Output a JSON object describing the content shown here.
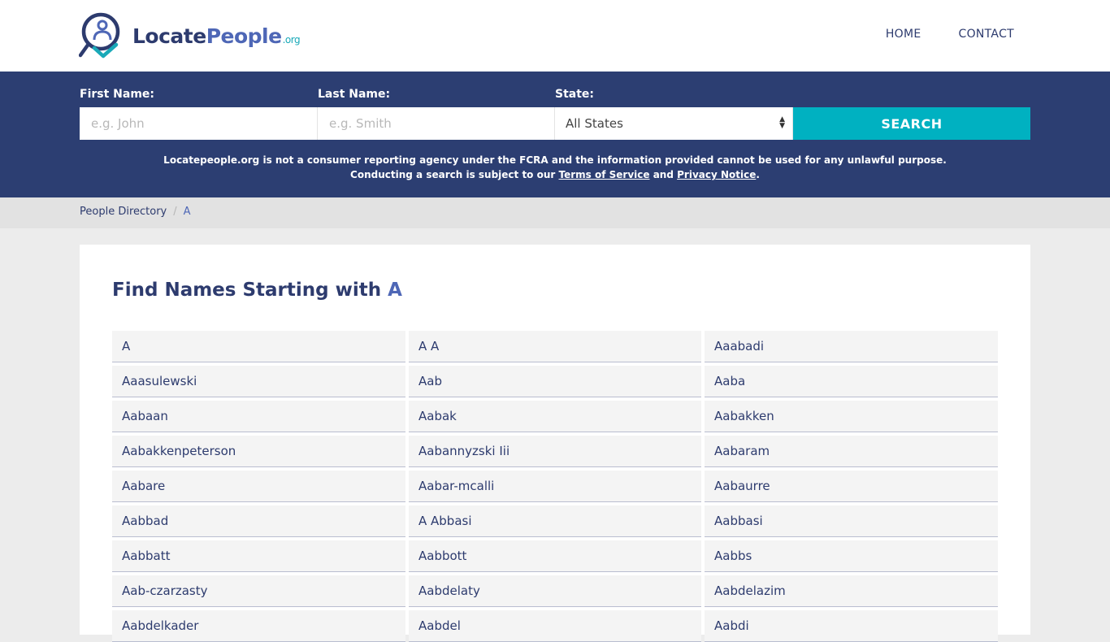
{
  "header": {
    "logo": {
      "locate": "Locate",
      "people": "People",
      "org": ".org",
      "icon": "location-pin-person-icon"
    },
    "nav": [
      {
        "label": "HOME"
      },
      {
        "label": "CONTACT"
      }
    ]
  },
  "search": {
    "first_name": {
      "label": "First Name:",
      "placeholder": "e.g. John",
      "value": ""
    },
    "last_name": {
      "label": "Last Name:",
      "placeholder": "e.g. Smith",
      "value": ""
    },
    "state": {
      "label": "State:",
      "selected": "All States"
    },
    "button_label": "SEARCH",
    "disclaimer_line1": "Locatepeople.org is not a consumer reporting agency under the FCRA and the information provided cannot be used for any unlawful purpose.",
    "disclaimer_line2_prefix": "Conducting a search is subject to our",
    "terms_link": "Terms of Service",
    "and_text": "and",
    "privacy_link": "Privacy Notice",
    "period": "."
  },
  "breadcrumb": {
    "root": "People Directory",
    "separator": "/",
    "current": "A"
  },
  "main": {
    "title_prefix": "Find Names Starting with",
    "title_letter": "A",
    "names": [
      "A",
      "A A",
      "Aaabadi",
      "Aaasulewski",
      "Aab",
      "Aaba",
      "Aabaan",
      "Aabak",
      "Aabakken",
      "Aabakkenpeterson",
      "Aabannyzski Iii",
      "Aabaram",
      "Aabare",
      "Aabar-mcalli",
      "Aabaurre",
      "Aabbad",
      "A Abbasi",
      "Aabbasi",
      "Aabbatt",
      "Aabbott",
      "Aabbs",
      "Aab-czarzasty",
      "Aabdelaty",
      "Aabdelazim",
      "Aabdelkader",
      "Aabdel",
      "Aabdi"
    ]
  },
  "colors": {
    "navy": "#2c3e72",
    "accent": "#00b1c1",
    "link_blue": "#4e67b6"
  }
}
